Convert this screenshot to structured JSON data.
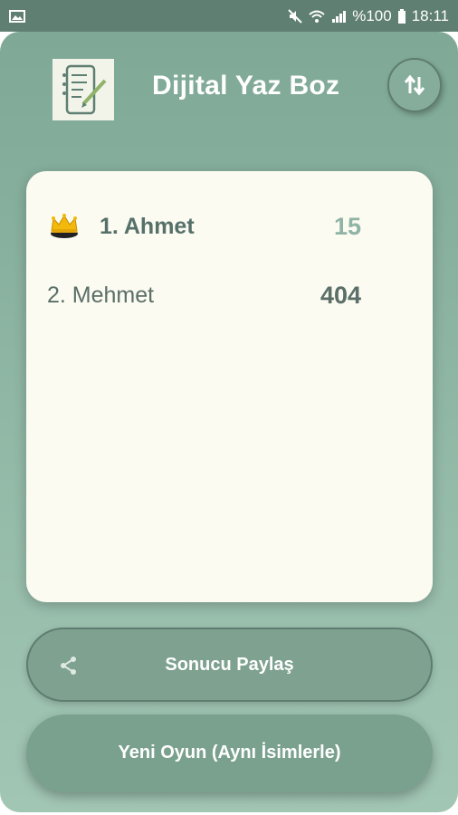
{
  "status_bar": {
    "battery": "%100",
    "time": "18:11",
    "icons": [
      "image-icon",
      "mute-icon",
      "wifi-icon",
      "signal-icon",
      "battery-icon"
    ]
  },
  "app": {
    "title": "Dijital Yaz Boz",
    "logo_icon": "notepad-pencil-icon",
    "sort_icon": "swap-vertical-icon"
  },
  "scoreboard": {
    "players": [
      {
        "rank_name": "1. Ahmet",
        "score": "15",
        "leader": true,
        "badge_icon": "crown-icon"
      },
      {
        "rank_name": "2. Mehmet",
        "score": "404",
        "leader": false
      }
    ]
  },
  "actions": {
    "share_label": "Sonucu Paylaş",
    "share_icon": "share-icon",
    "new_game_label": "Yeni Oyun (Aynı İsimlerle)"
  },
  "colors": {
    "status_bar": "#5f7f72",
    "panel_top": "#7fa896",
    "panel_bottom": "#a2c6b4",
    "card": "#fbfbf1",
    "leader_score": "#8fb3a4",
    "text_dark": "#5b6e68"
  }
}
